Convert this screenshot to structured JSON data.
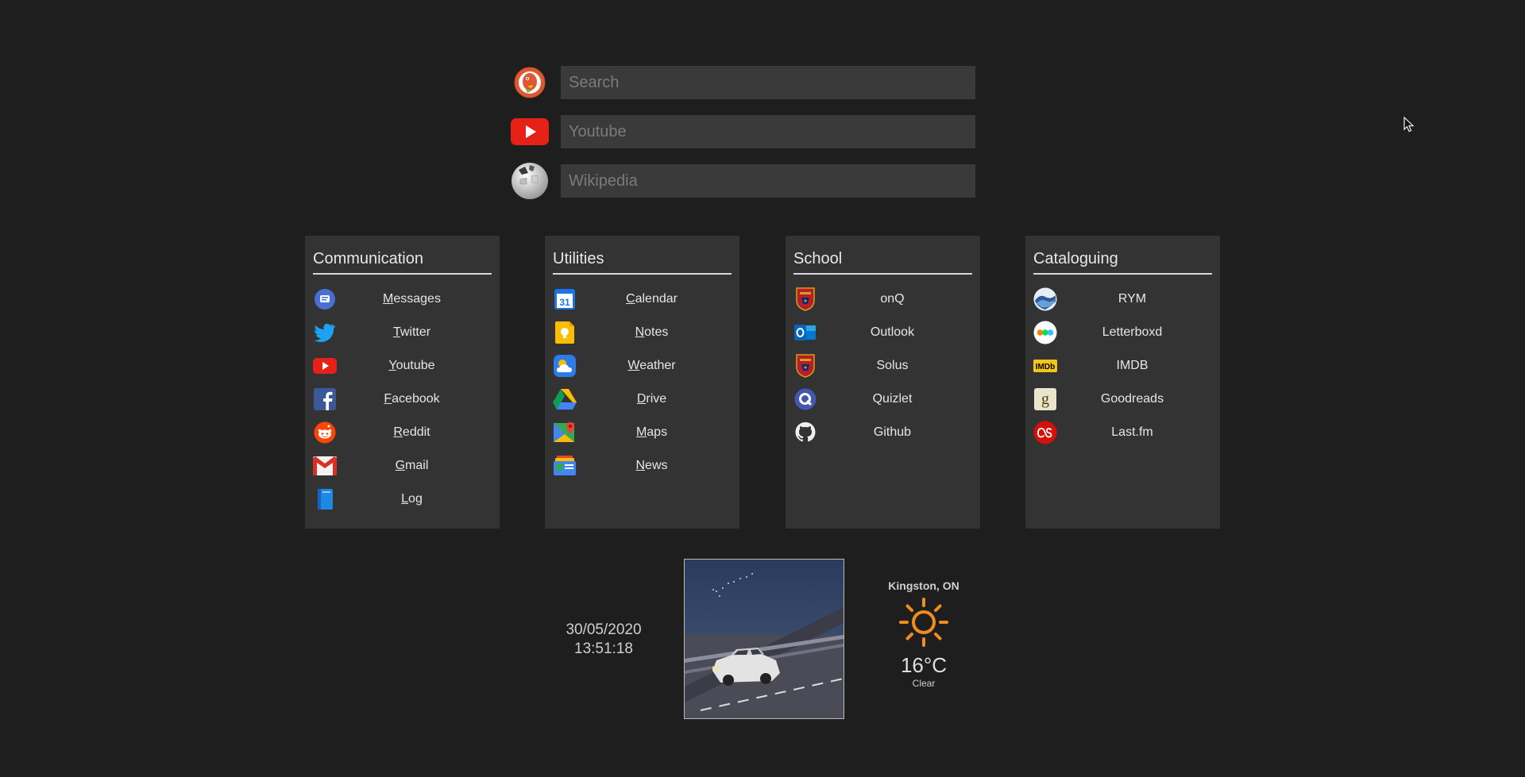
{
  "search": {
    "duckduckgo_placeholder": "Search",
    "youtube_placeholder": "Youtube",
    "wikipedia_placeholder": "Wikipedia"
  },
  "panels": [
    {
      "title": "Communication",
      "links": [
        {
          "label": "Messages",
          "icon": "messages-icon"
        },
        {
          "label": "Twitter",
          "icon": "twitter-icon"
        },
        {
          "label": "Youtube",
          "icon": "youtube-icon"
        },
        {
          "label": "Facebook",
          "icon": "facebook-icon"
        },
        {
          "label": "Reddit",
          "icon": "reddit-icon"
        },
        {
          "label": "Gmail",
          "icon": "gmail-icon"
        },
        {
          "label": "Log",
          "icon": "book-icon"
        }
      ]
    },
    {
      "title": "Utilities",
      "links": [
        {
          "label": "Calendar",
          "icon": "calendar-icon",
          "icon_text": "31"
        },
        {
          "label": "Notes",
          "icon": "keep-notes-icon"
        },
        {
          "label": "Weather",
          "icon": "weather-icon"
        },
        {
          "label": "Drive",
          "icon": "drive-icon"
        },
        {
          "label": "Maps",
          "icon": "maps-icon"
        },
        {
          "label": "News",
          "icon": "news-icon"
        }
      ]
    },
    {
      "title": "School",
      "links": [
        {
          "label": "onQ",
          "icon": "crest-icon"
        },
        {
          "label": "Outlook",
          "icon": "outlook-icon"
        },
        {
          "label": "Solus",
          "icon": "crest-icon"
        },
        {
          "label": "Quizlet",
          "icon": "quizlet-icon"
        },
        {
          "label": "Github",
          "icon": "github-icon"
        }
      ]
    },
    {
      "title": "Cataloguing",
      "links": [
        {
          "label": "RYM",
          "icon": "rym-icon"
        },
        {
          "label": "Letterboxd",
          "icon": "letterboxd-icon"
        },
        {
          "label": "IMDB",
          "icon": "imdb-icon",
          "icon_text": "IMDb"
        },
        {
          "label": "Goodreads",
          "icon": "goodreads-icon",
          "icon_text": "g"
        },
        {
          "label": "Last.fm",
          "icon": "lastfm-icon"
        }
      ]
    }
  ],
  "clock": {
    "date": "30/05/2020",
    "time": "13:51:18"
  },
  "weather": {
    "city": "Kingston, ON",
    "temperature": "16°C",
    "condition": "Clear",
    "icon": "sun-icon"
  },
  "colors": {
    "background": "#1e1e1e",
    "panel": "#333333",
    "input": "#3a3a3a",
    "sun": "#f28c1e"
  }
}
